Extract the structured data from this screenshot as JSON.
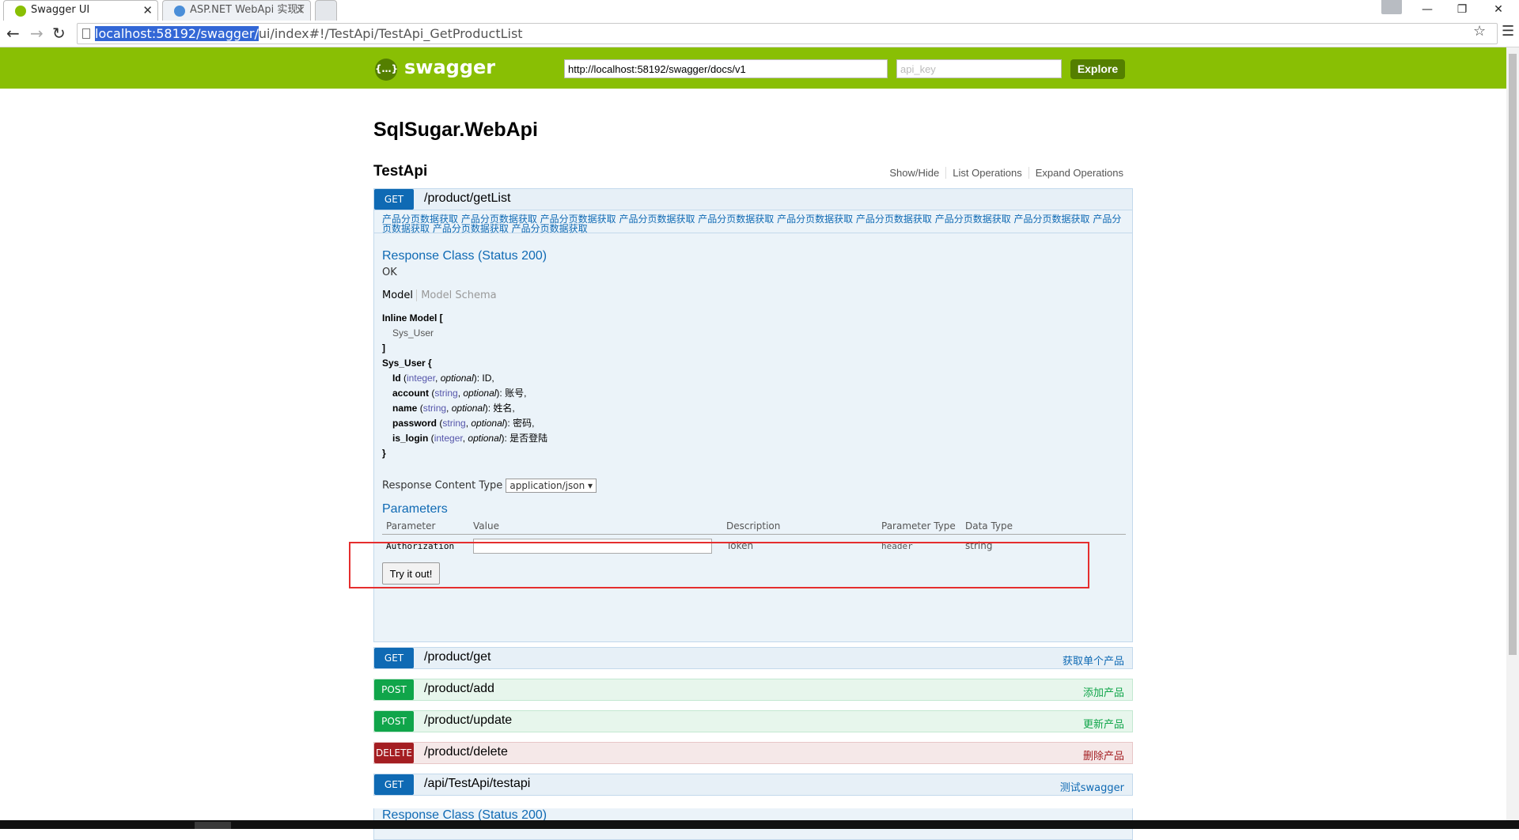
{
  "browser": {
    "tabs": [
      {
        "title": "Swagger UI",
        "active": true
      },
      {
        "title": "ASP.NET WebApi 实现T",
        "active": false
      }
    ],
    "close_glyph": "✕",
    "url_selected": "localhost:58192/swagger/",
    "url_rest": "ui/index#!/TestApi/TestApi_GetProductList"
  },
  "swagger": {
    "brand": "swagger",
    "spec_url": "http://localhost:58192/swagger/docs/v1",
    "api_key_placeholder": "api_key",
    "explore_label": "Explore"
  },
  "api": {
    "title": "SqlSugar.WebApi",
    "resource": "TestApi",
    "links": [
      "Show/Hide",
      "List Operations",
      "Expand Operations"
    ]
  },
  "expanded_op": {
    "method": "GET",
    "path": "/product/getList",
    "description": "产品分页数据获取 产品分页数据获取 产品分页数据获取 产品分页数据获取 产品分页数据获取 产品分页数据获取 产品分页数据获取 产品分页数据获取 产品分页数据获取 产品分页数据获取 产品分页数据获取 产品分页数据获取",
    "response_class_heading": "Response Class (Status 200)",
    "response_status": "OK",
    "model_tab": "Model",
    "model_schema_tab": "Model Schema",
    "model": {
      "inline_open": "Inline Model [",
      "inline_item": "Sys_User",
      "inline_close": "]",
      "class_open": "Sys_User {",
      "class_close": "}",
      "fields": [
        {
          "name": "Id",
          "type": "integer",
          "opt": "optional",
          "desc": ": ID,"
        },
        {
          "name": "account",
          "type": "string",
          "opt": "optional",
          "desc": ": 账号,"
        },
        {
          "name": "name",
          "type": "string",
          "opt": "optional",
          "desc": ": 姓名,"
        },
        {
          "name": "password",
          "type": "string",
          "opt": "optional",
          "desc": ": 密码,"
        },
        {
          "name": "is_login",
          "type": "integer",
          "opt": "optional",
          "desc": ": 是否登陆"
        }
      ]
    },
    "response_content_type_label": "Response Content Type",
    "response_content_type_value": "application/json",
    "parameters_heading": "Parameters",
    "param_headers": [
      "Parameter",
      "Value",
      "Description",
      "Parameter Type",
      "Data Type"
    ],
    "param_row": {
      "name": "Authorization",
      "value": "",
      "description": "Token",
      "param_type": "header",
      "data_type": "string"
    },
    "try_label": "Try it out!"
  },
  "operations": [
    {
      "method": "GET",
      "path": "/product/get",
      "summary": "获取单个产品"
    },
    {
      "method": "POST",
      "path": "/product/add",
      "summary": "添加产品"
    },
    {
      "method": "POST",
      "path": "/product/update",
      "summary": "更新产品"
    },
    {
      "method": "DELETE",
      "path": "/product/delete",
      "summary": "删除产品"
    },
    {
      "method": "GET",
      "path": "/api/TestApi/testapi",
      "summary": "测试swagger"
    }
  ],
  "colors": {
    "header_green": "#89bf04",
    "get": "#0f6ab4",
    "post": "#10a54a",
    "delete": "#a41e22",
    "highlight": "#e52e2e"
  }
}
